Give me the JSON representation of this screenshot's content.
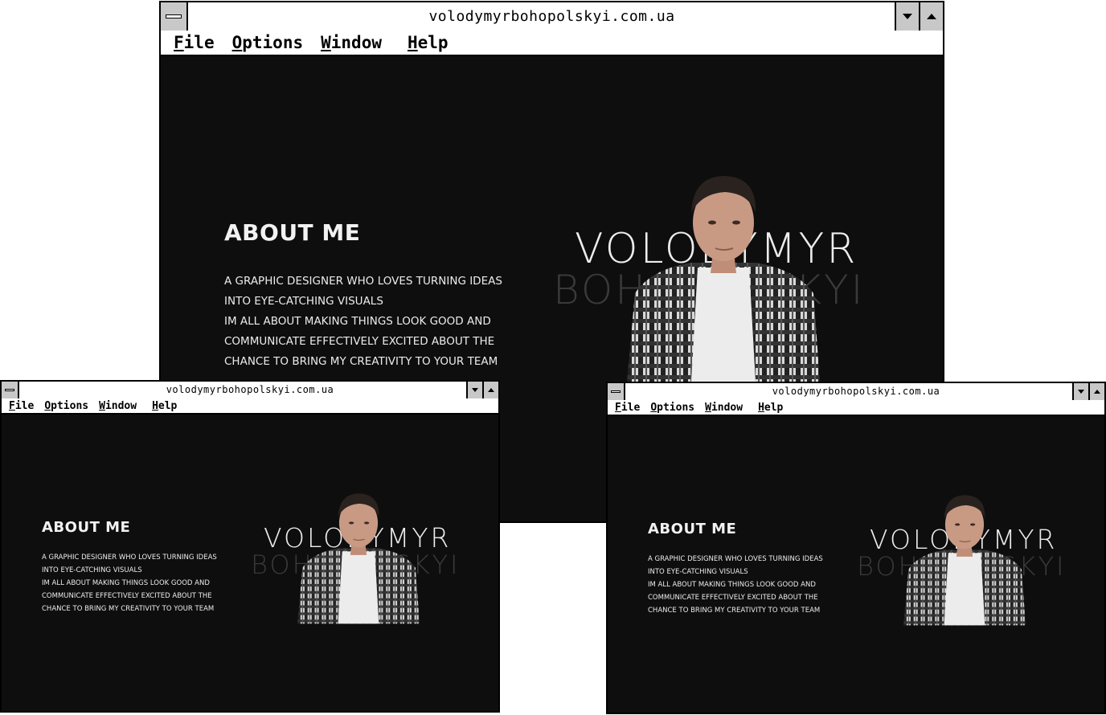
{
  "window": {
    "title": "volodymyrbohopolskyi.com.ua",
    "menu": [
      {
        "accel": "F",
        "rest": "ile"
      },
      {
        "accel": "O",
        "rest": "ptions"
      },
      {
        "accel": "W",
        "rest": "indow"
      },
      {
        "accel": "H",
        "rest": "elp"
      }
    ]
  },
  "about": {
    "heading": "ABOUT ME",
    "lines": [
      "A GRAPHIC DESIGNER WHO LOVES TURNING IDEAS",
      "INTO EYE-CATCHING VISUALS",
      "IM ALL ABOUT MAKING THINGS LOOK GOOD AND",
      "COMMUNICATE EFFECTIVELY EXCITED ABOUT THE",
      "CHANCE TO BRING MY CREATIVITY TO YOUR TEAM"
    ]
  },
  "hero": {
    "first_name": "VOLODYMYR",
    "last_name": "BOHOPOLSKYI"
  },
  "colors": {
    "content_bg": "#0e0e0e",
    "chrome_gray": "#c8c8c8",
    "shirt_white": "#ececec",
    "skin": "#c89a84",
    "hair": "#2a221f"
  }
}
